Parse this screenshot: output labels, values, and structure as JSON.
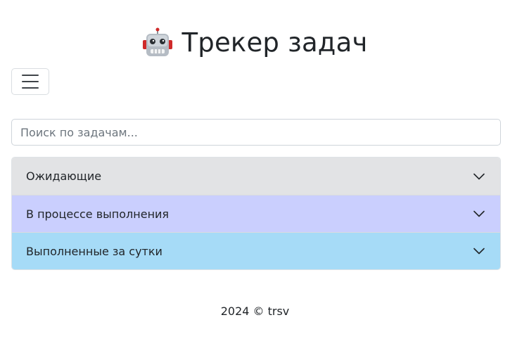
{
  "header": {
    "icon": "robot-icon",
    "title": "Трекер задач"
  },
  "menu": {
    "icon": "hamburger-menu-icon"
  },
  "search": {
    "placeholder": "Поиск по задачам...",
    "value": ""
  },
  "accordion": {
    "items": [
      {
        "label": "Ожидающие",
        "color": "#e2e3e5",
        "icon": "chevron-down-icon"
      },
      {
        "label": "В процессе выполнения",
        "color": "#cacffe",
        "icon": "chevron-down-icon"
      },
      {
        "label": "Выполненные за сутки",
        "color": "#a6dbf7",
        "icon": "chevron-down-icon"
      }
    ]
  },
  "footer": {
    "text": "2024 © trsv"
  }
}
